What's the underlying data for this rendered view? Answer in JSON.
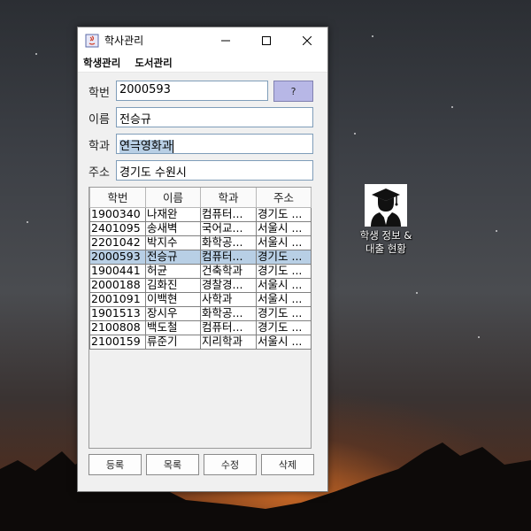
{
  "window": {
    "title": "학사관리",
    "menus": [
      "학생관리",
      "도서관리"
    ]
  },
  "form": {
    "student_id_label": "학번",
    "student_id_value": "2000593",
    "query_button": "?",
    "name_label": "이름",
    "name_value": "전승규",
    "major_label": "학과",
    "major_value": "연극영화과",
    "address_label": "주소",
    "address_value": "경기도 수원시"
  },
  "table": {
    "columns": [
      "학번",
      "이름",
      "학과",
      "주소"
    ],
    "rows": [
      [
        "1900340",
        "나재완",
        "컴퓨터...",
        "경기도 ..."
      ],
      [
        "2401095",
        "송새벽",
        "국어교...",
        "서울시 ..."
      ],
      [
        "2201042",
        "박지수",
        "화학공...",
        "서울시 ..."
      ],
      [
        "2000593",
        "전승규",
        "컴퓨터...",
        "경기도 ..."
      ],
      [
        "1900441",
        "허균",
        "건축학과",
        "경기도 ..."
      ],
      [
        "2000188",
        "김화진",
        "경찰경...",
        "서울시 ..."
      ],
      [
        "2001091",
        "이백현",
        "사학과",
        "서울시 ..."
      ],
      [
        "1901513",
        "장시우",
        "화학공...",
        "경기도 ..."
      ],
      [
        "2100808",
        "백도철",
        "컴퓨터...",
        "경기도 ..."
      ],
      [
        "2100159",
        "류준기",
        "지리학과",
        "서울시 ..."
      ]
    ],
    "selected_row_index": 3
  },
  "buttons": {
    "register": "등록",
    "list": "목록",
    "edit": "수정",
    "delete": "삭제"
  },
  "desktop_icon": {
    "label_line1": "학생 정보 &",
    "label_line2": "대출 현황",
    "icon": "graduate-icon"
  },
  "colors": {
    "selection": "#b8cfe5",
    "query_button": "#b7b7e6"
  }
}
